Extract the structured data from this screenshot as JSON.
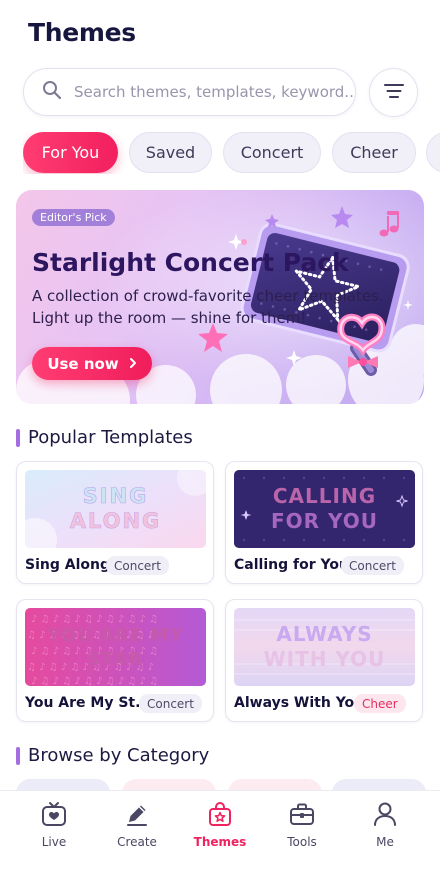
{
  "header": {
    "title": "Themes"
  },
  "search": {
    "placeholder": "Search themes, templates, keyword..."
  },
  "chips": [
    {
      "label": "For You",
      "active": true
    },
    {
      "label": "Saved"
    },
    {
      "label": "Concert"
    },
    {
      "label": "Cheer"
    }
  ],
  "hero": {
    "badge": "Editor's Pick",
    "title": "Starlight Concert Pack",
    "desc_line1": "A collection of crowd-favorite cheer templates.",
    "desc_line2": "Light up the room — shine for them!",
    "button": "Use now",
    "button_icon": "chevron-right-icon"
  },
  "popular": {
    "title": "Popular Templates",
    "cards": [
      {
        "name": "Sing Along",
        "tag": "Concert",
        "art_text": [
          "SING",
          "ALONG"
        ]
      },
      {
        "name": "Calling for You",
        "tag": "Concert",
        "art_text": [
          "CALLING",
          "FOR YOU"
        ]
      },
      {
        "name": "You Are My St...",
        "tag": "Concert",
        "art_text": [
          "YOU ARE MY",
          "STAR"
        ]
      },
      {
        "name": "Always With You",
        "tag": "Cheer",
        "art_text": [
          "ALWAYS",
          "WITH YOU"
        ]
      }
    ]
  },
  "browse": {
    "title": "Browse by Category"
  },
  "tabbar": [
    {
      "label": "Live",
      "icon": "heart-tv-icon"
    },
    {
      "label": "Create",
      "icon": "pencil-icon"
    },
    {
      "label": "Themes",
      "icon": "theme-bag-icon",
      "active": true
    },
    {
      "label": "Tools",
      "icon": "toolbox-icon"
    },
    {
      "label": "Me",
      "icon": "person-icon"
    }
  ],
  "colors": {
    "accent": "#f0225f",
    "purple": "#a46de2",
    "ink": "#16163f"
  }
}
